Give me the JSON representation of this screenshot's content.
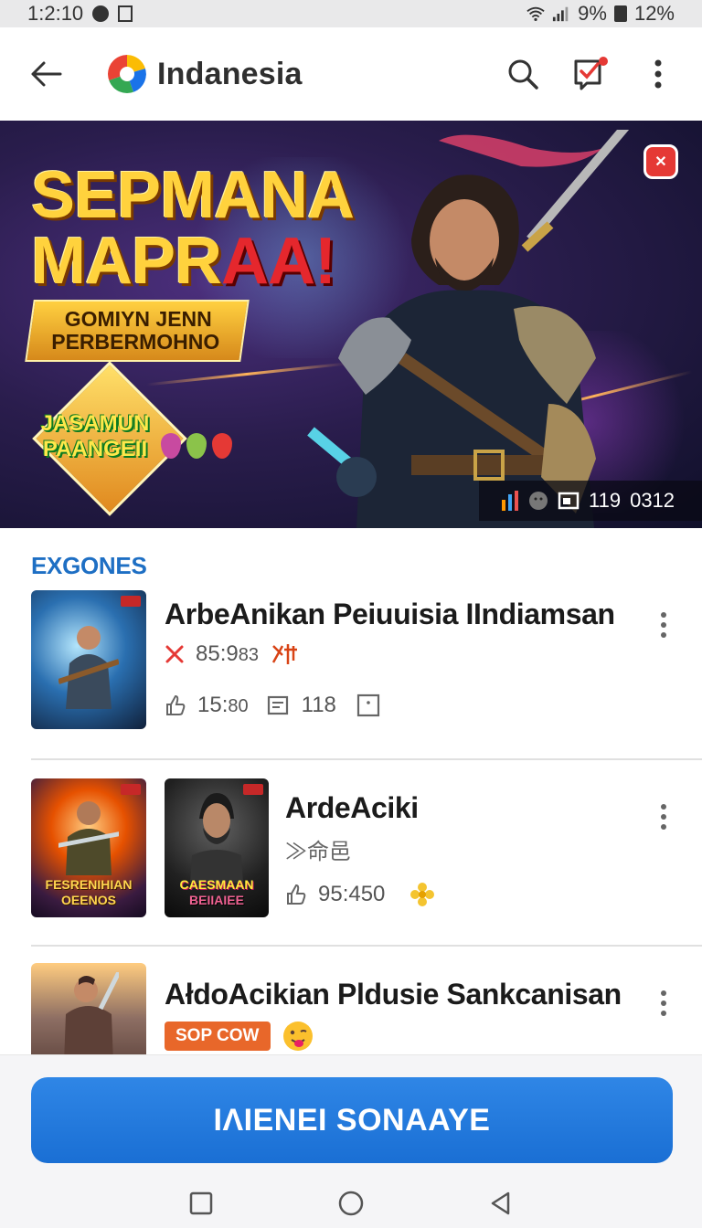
{
  "status_bar": {
    "time": "1:2:10",
    "battery_a": "9%",
    "battery_b": "12%"
  },
  "app_bar": {
    "title": "Indanesia",
    "icons": [
      "back-arrow-icon",
      "app-logo",
      "search-icon",
      "notification-check-icon",
      "more-vert-icon"
    ]
  },
  "banner": {
    "title_line1": "SEPMANA",
    "title_line2_main": "MAPR",
    "title_line2_red": "AA!",
    "plate_line1": "GOMIYN JENN",
    "plate_line2": "PERBERMOHNO",
    "badge_line1": "JASAMUN",
    "badge_line2": "PAANGEII",
    "footer_value_a": "119",
    "footer_value_b": "0312",
    "colors": {
      "title": "#ffd23d",
      "title_accent": "#e5272d",
      "badge_red": "#e53935"
    }
  },
  "section": {
    "title": "EXGONES"
  },
  "items": [
    {
      "title": "ArbeAnikan Peiuuisia IIndiamsan",
      "rating": "85:9",
      "rating_suffix": "83",
      "stat_likes": "15:",
      "stat_likes_suffix": "80",
      "stat_comments": "118"
    },
    {
      "title": "ArdeAciki",
      "subtitle": "≫命邑",
      "thumb_a_caption_1": "FESRENIHIAN",
      "thumb_a_caption_2": "OEENOS",
      "thumb_b_caption_1": "CAESMAAN",
      "thumb_b_caption_2": "BEIIAIEE",
      "stat_likes": "95:450"
    },
    {
      "title": "AłdoAcikian Pldusie Sankcanisan",
      "chip": "SOP COW"
    }
  ],
  "cta": {
    "label": "IΛIENEI SONAAYE",
    "color": "#1a6fd4"
  },
  "nav_bar": {
    "icons": [
      "recents-square-icon",
      "home-circle-icon",
      "back-triangle-icon"
    ]
  }
}
